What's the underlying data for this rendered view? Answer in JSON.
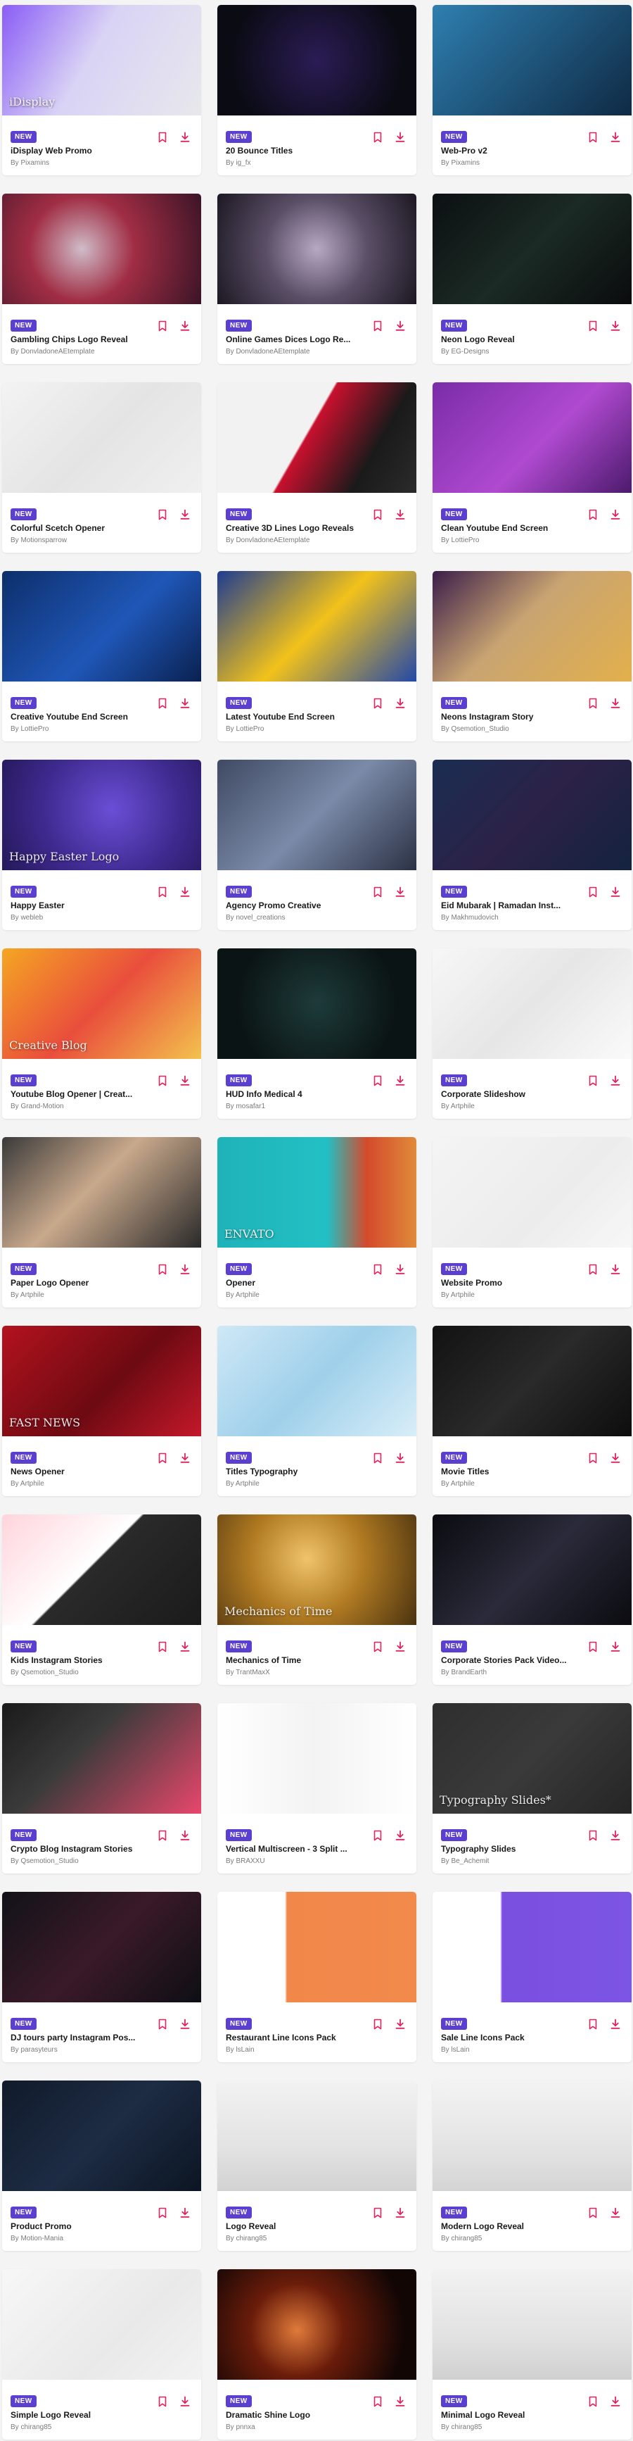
{
  "ui": {
    "badge_color": "#5b3fd1",
    "action_color": "#e0245e",
    "bookmark_icon": "bookmark-icon",
    "download_icon": "download-icon"
  },
  "items": [
    {
      "badge": "NEW",
      "title": "iDisplay Web Promo",
      "author": "By Pixamins",
      "thumb_bg": "linear-gradient(120deg,#8a5cf6 0%,#d9d3f5 45%,#e8e8ec 100%)",
      "caption": "iDisplay"
    },
    {
      "badge": "NEW",
      "title": "20 Bounce Titles",
      "author": "By ig_fx",
      "thumb_bg": "radial-gradient(circle at 50% 50%,#2b1c55 0%,#0b0b14 75%)",
      "caption": ""
    },
    {
      "badge": "NEW",
      "title": "Web-Pro v2",
      "author": "By Pixamins",
      "thumb_bg": "linear-gradient(135deg,#2e7fb0 0%,#0f2a44 100%)",
      "caption": ""
    },
    {
      "badge": "NEW",
      "title": "Gambling Chips Logo Reveal",
      "author": "By DonvladoneAEtemplate",
      "thumb_bg": "radial-gradient(circle at 40% 50%,#d0bcc8 0%,#a02d44 40%,#3b1426 100%)",
      "caption": ""
    },
    {
      "badge": "NEW",
      "title": "Online Games Dices Logo Re...",
      "author": "By DonvladoneAEtemplate",
      "thumb_bg": "radial-gradient(circle at 50% 50%,#b7a8c4 0%,#5a4e66 45%,#1c1822 100%)",
      "caption": ""
    },
    {
      "badge": "NEW",
      "title": "Neon Logo Reveal",
      "author": "By EG-Designs",
      "thumb_bg": "linear-gradient(135deg,#0c1012 0%,#1b2a24 50%,#0a0c0d 100%)",
      "caption": ""
    },
    {
      "badge": "NEW",
      "title": "Colorful Scetch Opener",
      "author": "By Motionsparrow",
      "thumb_bg": "linear-gradient(135deg,#f3f3f3 0%,#e4e4e4 50%,#f0f0f0 100%)",
      "caption": ""
    },
    {
      "badge": "NEW",
      "title": "Creative 3D Lines Logo Reveals",
      "author": "By DonvladoneAEtemplate",
      "thumb_bg": "linear-gradient(120deg,#f2f2f2 0%,#f2f2f2 45%,#c8102e 46%,#1a1a1a 75%,#2b2b2b 100%)",
      "caption": ""
    },
    {
      "badge": "NEW",
      "title": "Clean Youtube End Screen",
      "author": "By LottiePro",
      "thumb_bg": "linear-gradient(135deg,#7a2ca8 0%,#b04ad0 55%,#4c1a6c 100%)",
      "caption": ""
    },
    {
      "badge": "NEW",
      "title": "Creative Youtube End Screen",
      "author": "By LottiePro",
      "thumb_bg": "linear-gradient(135deg,#0d2f6b 0%,#1f57b8 55%,#0a2150 100%)",
      "caption": ""
    },
    {
      "badge": "NEW",
      "title": "Latest Youtube End Screen",
      "author": "By LottiePro",
      "thumb_bg": "linear-gradient(135deg,#1f3c8f 0%,#f2c21a 50%,#2348a8 100%)",
      "caption": ""
    },
    {
      "badge": "NEW",
      "title": "Neons Instagram Story",
      "author": "By Qsemotion_Studio",
      "thumb_bg": "linear-gradient(135deg,#3a1d4a 0%,#c9a472 45%,#e2b04b 100%)",
      "caption": ""
    },
    {
      "badge": "NEW",
      "title": "Happy Easter",
      "author": "By webleb",
      "thumb_bg": "radial-gradient(circle at 55% 45%,#6b4ed6 0%,#3e2a8f 55%,#25185a 100%)",
      "caption": "Happy Easter Logo"
    },
    {
      "badge": "NEW",
      "title": "Agency Promo Creative",
      "author": "By novel_creations",
      "thumb_bg": "linear-gradient(135deg,#3f4a63 0%,#7a8aa8 50%,#2c3245 100%)",
      "caption": ""
    },
    {
      "badge": "NEW",
      "title": "Eid Mubarak | Ramadan Inst...",
      "author": "By Makhmudovich",
      "thumb_bg": "linear-gradient(135deg,#1a2d52 0%,#2c2147 50%,#14233f 100%)",
      "caption": ""
    },
    {
      "badge": "NEW",
      "title": "Youtube Blog Opener | Creat...",
      "author": "By Grand-Motion",
      "thumb_bg": "linear-gradient(135deg,#f5a623 0%,#e94e3c 50%,#f3c24e 100%)",
      "caption": "Creative Blog"
    },
    {
      "badge": "NEW",
      "title": "HUD Info Medical 4",
      "author": "By mosafar1",
      "thumb_bg": "radial-gradient(circle at 50% 50%,#1d3b3a 0%,#0b1414 70%)",
      "caption": ""
    },
    {
      "badge": "NEW",
      "title": "Corporate Slideshow",
      "author": "By Artphile",
      "thumb_bg": "linear-gradient(135deg,#f7f7f7 0%,#e6e6e6 50%,#fafafa 100%)",
      "caption": ""
    },
    {
      "badge": "NEW",
      "title": "Paper Logo Opener",
      "author": "By Artphile",
      "thumb_bg": "linear-gradient(135deg,#3a3a3a 0%,#c9a98c 45%,#2a2a2a 100%)",
      "caption": ""
    },
    {
      "badge": "NEW",
      "title": "Opener",
      "author": "By Artphile",
      "thumb_bg": "linear-gradient(90deg,#1fb3b8 0%,#22c0c4 55%,#d44a2c 75%,#e08a3a 100%)",
      "caption": "ENVATO"
    },
    {
      "badge": "NEW",
      "title": "Website Promo",
      "author": "By Artphile",
      "thumb_bg": "linear-gradient(135deg,#f4f4f4 0%,#ececec 60%,#f7f7f7 100%)",
      "caption": ""
    },
    {
      "badge": "NEW",
      "title": "News Opener",
      "author": "By Artphile",
      "thumb_bg": "linear-gradient(135deg,#b3121e 0%,#6d0a12 55%,#c4182a 100%)",
      "caption": "FAST NEWS"
    },
    {
      "badge": "NEW",
      "title": "Titles Typography",
      "author": "By Artphile",
      "thumb_bg": "linear-gradient(135deg,#cfe8f6 0%,#9fd0ea 50%,#d8eef8 100%)",
      "caption": ""
    },
    {
      "badge": "NEW",
      "title": "Movie Titles",
      "author": "By Artphile",
      "thumb_bg": "linear-gradient(135deg,#121212 0%,#2a2a2a 50%,#0d0d0d 100%)",
      "caption": ""
    },
    {
      "badge": "NEW",
      "title": "Kids Instagram Stories",
      "author": "By Qsemotion_Studio",
      "thumb_bg": "linear-gradient(135deg,#ffd4dc 0%,#ffffff 45%,#2a2a2a 46%,#1a1a1a 100%)",
      "caption": ""
    },
    {
      "badge": "NEW",
      "title": "Mechanics of Time",
      "author": "By TrantMaxX",
      "thumb_bg": "radial-gradient(circle at 45% 40%,#f0c46a 0%,#b07a22 45%,#4a3210 100%)",
      "caption": "Mechanics of Time"
    },
    {
      "badge": "NEW",
      "title": "Corporate Stories Pack Video...",
      "author": "By BrandEarth",
      "thumb_bg": "linear-gradient(135deg,#0b0b10 0%,#2a2a3a 50%,#0b0b10 100%)",
      "caption": ""
    },
    {
      "badge": "NEW",
      "title": "Crypto Blog Instagram Stories",
      "author": "By Qsemotion_Studio",
      "thumb_bg": "linear-gradient(135deg,#1a1a1a 0%,#3b3b3b 40%,#e8476b 100%)",
      "caption": ""
    },
    {
      "badge": "NEW",
      "title": "Vertical Multiscreen - 3 Split ...",
      "author": "By BRAXXU",
      "thumb_bg": "linear-gradient(90deg,#ffffff 0%,#f3f3f3 50%,#ffffff 100%)",
      "caption": ""
    },
    {
      "badge": "NEW",
      "title": "Typography Slides",
      "author": "By Be_Achemit",
      "thumb_bg": "linear-gradient(135deg,#2e2e2e 0%,#3a3a3a 50%,#252525 100%)",
      "caption": "Typography Slides*"
    },
    {
      "badge": "NEW",
      "title": "DJ tours party Instagram Pos...",
      "author": "By parasyteurs",
      "thumb_bg": "linear-gradient(135deg,#121218 0%,#3a1a28 50%,#0e0e14 100%)",
      "caption": ""
    },
    {
      "badge": "NEW",
      "title": "Restaurant Line Icons Pack",
      "author": "By lsLain",
      "thumb_bg": "linear-gradient(90deg,#ffffff 0%,#ffffff 34%,#f2874a 35%,#f28a4c 100%)",
      "caption": ""
    },
    {
      "badge": "NEW",
      "title": "Sale Line Icons Pack",
      "author": "By lsLain",
      "thumb_bg": "linear-gradient(90deg,#ffffff 0%,#ffffff 34%,#7a4fe0 35%,#7d55e4 100%)",
      "caption": ""
    },
    {
      "badge": "NEW",
      "title": "Product Promo",
      "author": "By Motion-Mania",
      "thumb_bg": "linear-gradient(135deg,#101a2a 0%,#1d2c44 50%,#0c1522 100%)",
      "caption": ""
    },
    {
      "badge": "NEW",
      "title": "Logo Reveal",
      "author": "By chirang85",
      "thumb_bg": "linear-gradient(180deg,#f2f2f2 0%,#e3e3e3 60%,#d2d2d2 100%)",
      "caption": ""
    },
    {
      "badge": "NEW",
      "title": "Modern Logo Reveal",
      "author": "By chirang85",
      "thumb_bg": "linear-gradient(180deg,#f3f3f3 0%,#e4e4e4 60%,#d4d4d4 100%)",
      "caption": ""
    },
    {
      "badge": "NEW",
      "title": "Simple Logo Reveal",
      "author": "By chirang85",
      "thumb_bg": "linear-gradient(135deg,#f7f7f7 0%,#e9e9e9 60%,#f2f2f2 100%)",
      "caption": ""
    },
    {
      "badge": "NEW",
      "title": "Dramatic Shine Logo",
      "author": "By pnnxa",
      "thumb_bg": "radial-gradient(circle at 40% 55%,#e07a3a 0%,#6a1c0a 35%,#120605 80%)",
      "caption": ""
    },
    {
      "badge": "NEW",
      "title": "Minimal Logo Reveal",
      "author": "By chirang85",
      "thumb_bg": "linear-gradient(180deg,#f2f2f2 0%,#e2e2e2 60%,#d0d0d0 100%)",
      "caption": ""
    }
  ]
}
